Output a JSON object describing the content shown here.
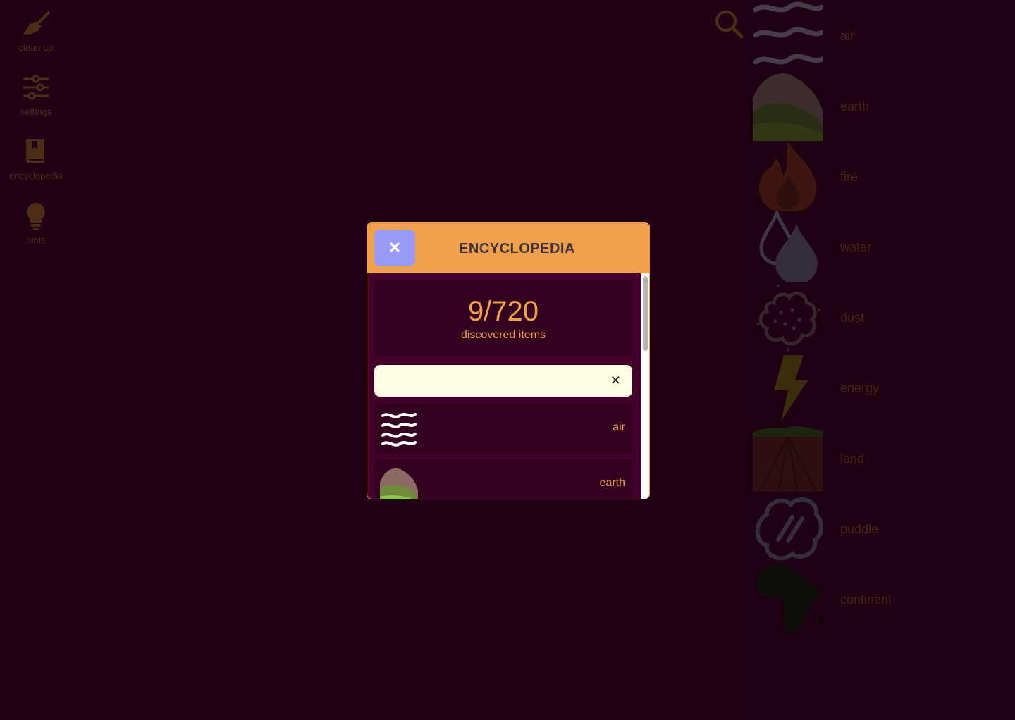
{
  "toolbar": {
    "items": [
      {
        "label": "clean up",
        "icon": "broom-icon"
      },
      {
        "label": "settings",
        "icon": "sliders-icon"
      },
      {
        "label": "encyclopedia",
        "icon": "book-icon"
      },
      {
        "label": "hints",
        "icon": "lightbulb-icon"
      }
    ]
  },
  "search": {
    "icon": "search-icon"
  },
  "sidebar": {
    "elements": [
      {
        "label": "air",
        "icon": "air-icon"
      },
      {
        "label": "earth",
        "icon": "earth-icon"
      },
      {
        "label": "fire",
        "icon": "fire-icon"
      },
      {
        "label": "water",
        "icon": "water-icon"
      },
      {
        "label": "dust",
        "icon": "dust-icon"
      },
      {
        "label": "energy",
        "icon": "energy-icon"
      },
      {
        "label": "land",
        "icon": "land-icon"
      },
      {
        "label": "puddle",
        "icon": "puddle-icon"
      },
      {
        "label": "continent",
        "icon": "continent-icon"
      }
    ]
  },
  "modal": {
    "close_label": "✕",
    "title": "ENCYCLOPEDIA",
    "count": "9/720",
    "count_label": "discovered items",
    "filter": {
      "value": "",
      "placeholder": "",
      "clear_label": "✕"
    },
    "items": [
      {
        "label": "air",
        "icon": "air-icon"
      },
      {
        "label": "earth",
        "icon": "earth-icon"
      }
    ]
  },
  "colors": {
    "accent": "#f0a04b",
    "close_button": "#9a9af8",
    "background": "#43002a",
    "filter_background": "#fffee4"
  }
}
